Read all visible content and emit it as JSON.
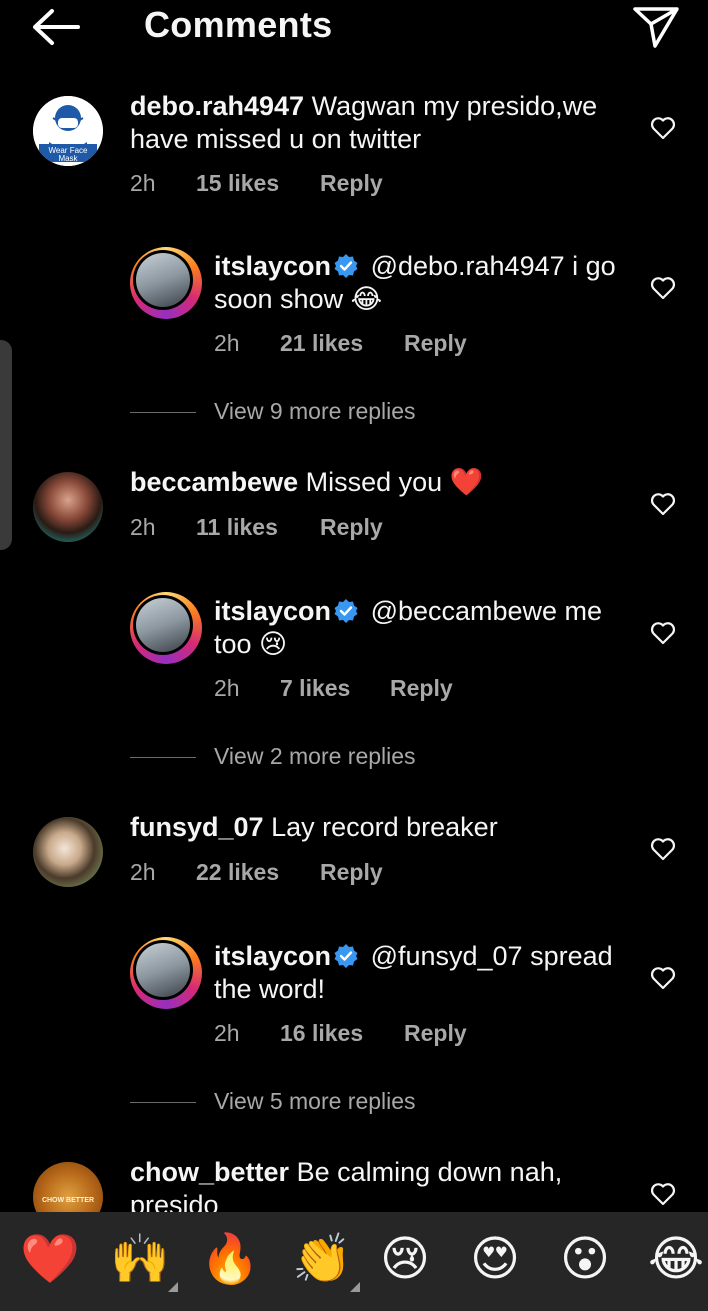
{
  "header": {
    "title": "Comments"
  },
  "comments": [
    {
      "user": "debo.rah4947",
      "text": "Wagwan my presido,we",
      "text2": "have missed u on twitter",
      "time": "2h",
      "likes": "15 likes",
      "reply": "Reply",
      "avatar_text": "Wear Face Mask"
    },
    {
      "user": "itslaycon",
      "text": "@debo.rah4947 i go",
      "text2": "soon show 😂",
      "time": "2h",
      "likes": "21 likes",
      "reply": "Reply"
    },
    {
      "view_more": "View 9 more replies"
    },
    {
      "user": "beccambewe",
      "text": "Missed you ❤️",
      "time": "2h",
      "likes": "11 likes",
      "reply": "Reply"
    },
    {
      "user": "itslaycon",
      "text": "@beccambewe me",
      "text2": "too 😢",
      "time": "2h",
      "likes": "7 likes",
      "reply": "Reply"
    },
    {
      "view_more": "View 2 more replies"
    },
    {
      "user": "funsyd_07",
      "text": "Lay record breaker",
      "time": "2h",
      "likes": "22 likes",
      "reply": "Reply"
    },
    {
      "user": "itslaycon",
      "text": "@funsyd_07 spread",
      "text2": "the word!",
      "time": "2h",
      "likes": "16 likes",
      "reply": "Reply"
    },
    {
      "view_more": "View 5 more replies"
    },
    {
      "user": "chow_better",
      "text": "Be calming down nah,",
      "text2": "presido",
      "avatar_text": "CHOW BETTER"
    }
  ],
  "reactions": [
    "❤️",
    "🙌",
    "🔥",
    "👏",
    "😢",
    "😍",
    "😮",
    "😂"
  ],
  "colors": {
    "background": "#000000",
    "secondary_text": "#a8a8a8",
    "verified": "#3897f0",
    "reaction_bar": "#262626"
  }
}
